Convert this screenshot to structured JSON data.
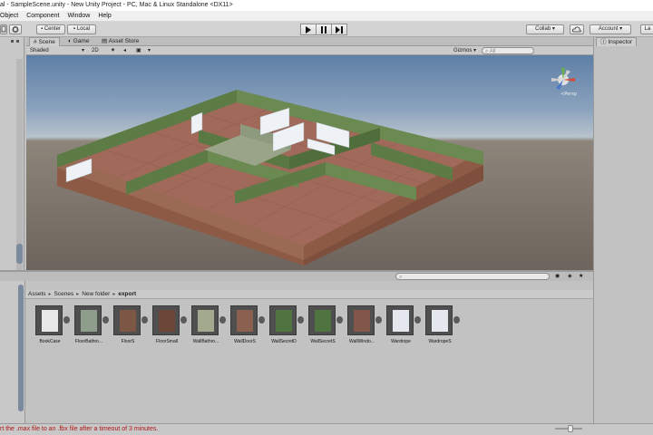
{
  "window": {
    "title": "al - SampleScene.unity - New Unity Project - PC, Mac & Linux Standalone <DX11>"
  },
  "menu": {
    "items": [
      "Object",
      "Component",
      "Window",
      "Help"
    ]
  },
  "toolbar": {
    "center_label": "Center",
    "local_label": "Local",
    "collab_label": "Collab",
    "account_label": "Account",
    "layers_label": "La"
  },
  "scene": {
    "tabs": [
      "Scene",
      "Game",
      "Asset Store"
    ],
    "shading_mode": "Shaded",
    "mode_2d": "2D",
    "gizmos_label": "Gizmos",
    "search_placeholder": "All"
  },
  "inspector": {
    "tab_label": "Inspector"
  },
  "project": {
    "breadcrumb": [
      "Assets",
      "Scenes",
      "New folder",
      "export"
    ],
    "assets": [
      {
        "label": "BookCase",
        "color": "#e9e9e9"
      },
      {
        "label": "FloorBathro...",
        "color": "#8f9d8c"
      },
      {
        "label": "FloorS",
        "color": "#7e5645"
      },
      {
        "label": "FloorSmall",
        "color": "#6a4738"
      },
      {
        "label": "WallBathro...",
        "color": "#a3a98f"
      },
      {
        "label": "WallDoorS",
        "color": "#8a6050"
      },
      {
        "label": "WallSecretD",
        "color": "#4f7440"
      },
      {
        "label": "WallSecretS",
        "color": "#4f7440"
      },
      {
        "label": "WallWindo...",
        "color": "#80574a"
      },
      {
        "label": "Wardrope",
        "color": "#e4e8ee"
      },
      {
        "label": "WardropeS",
        "color": "#e4e8ee"
      }
    ]
  },
  "status": {
    "message": "rt the .max file to an .fbx file after a timeout of 3 minutes."
  },
  "colors": {
    "wall_green": "#5d7c45",
    "wall_brick": "#8c5a45",
    "floor": "#a0695a",
    "status_red": "#b01515"
  }
}
